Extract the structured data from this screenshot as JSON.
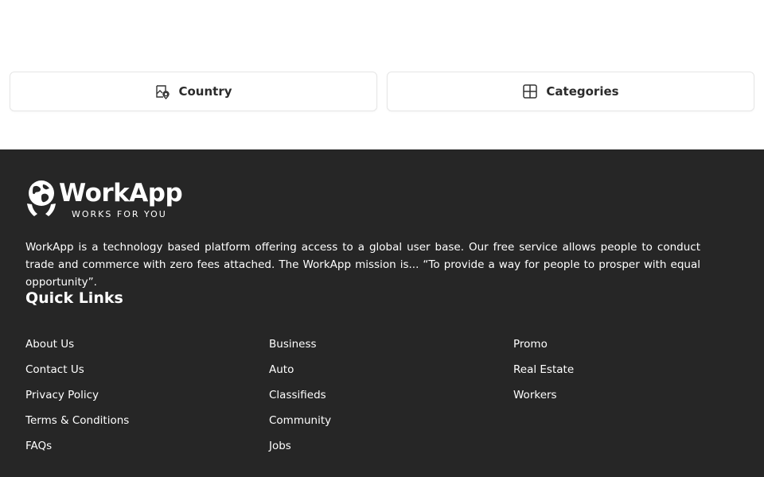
{
  "filters": {
    "country": {
      "label": "Country",
      "icon": "map-pin-icon"
    },
    "categories": {
      "label": "Categories",
      "icon": "grid-icon"
    }
  },
  "footer": {
    "brand": {
      "name": "WorkApp",
      "tagline": "WORKS FOR YOU"
    },
    "description": "WorkApp is a technology based platform offering access to a global user base. Our free service allows people to conduct trade and commerce with zero fees attached. The WorkApp mission is... “To provide a way for people to prosper with equal opportunity”.",
    "quick_links_title": "Quick Links",
    "columns": [
      [
        "About Us",
        "Contact Us",
        "Privacy Policy",
        "Terms & Conditions",
        "FAQs"
      ],
      [
        "Business",
        "Auto",
        "Classifieds",
        "Community",
        "Jobs"
      ],
      [
        "Promo",
        "Real Estate",
        "Workers"
      ]
    ],
    "colors": {
      "background": "#262626",
      "text": "#ffffff"
    }
  }
}
